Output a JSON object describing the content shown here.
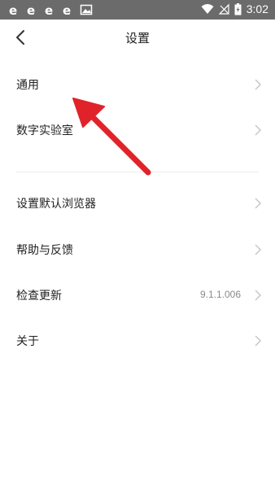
{
  "status_bar": {
    "time": "3:02"
  },
  "header": {
    "title": "设置"
  },
  "group1": [
    {
      "label": "通用"
    },
    {
      "label": "数字实验室"
    }
  ],
  "group2": [
    {
      "label": "设置默认浏览器",
      "value": ""
    },
    {
      "label": "帮助与反馈",
      "value": ""
    },
    {
      "label": "检查更新",
      "value": "9.1.1.006"
    },
    {
      "label": "关于",
      "value": ""
    }
  ],
  "colors": {
    "status_bar": "#6b6b6b",
    "arrow": "#e0232a",
    "text": "#222222",
    "chevron": "#c8c8c8"
  },
  "icons": [
    "ie-icon",
    "image-icon",
    "wifi-icon",
    "signal-icon",
    "battery-icon",
    "back-icon",
    "chevron-right-icon"
  ]
}
